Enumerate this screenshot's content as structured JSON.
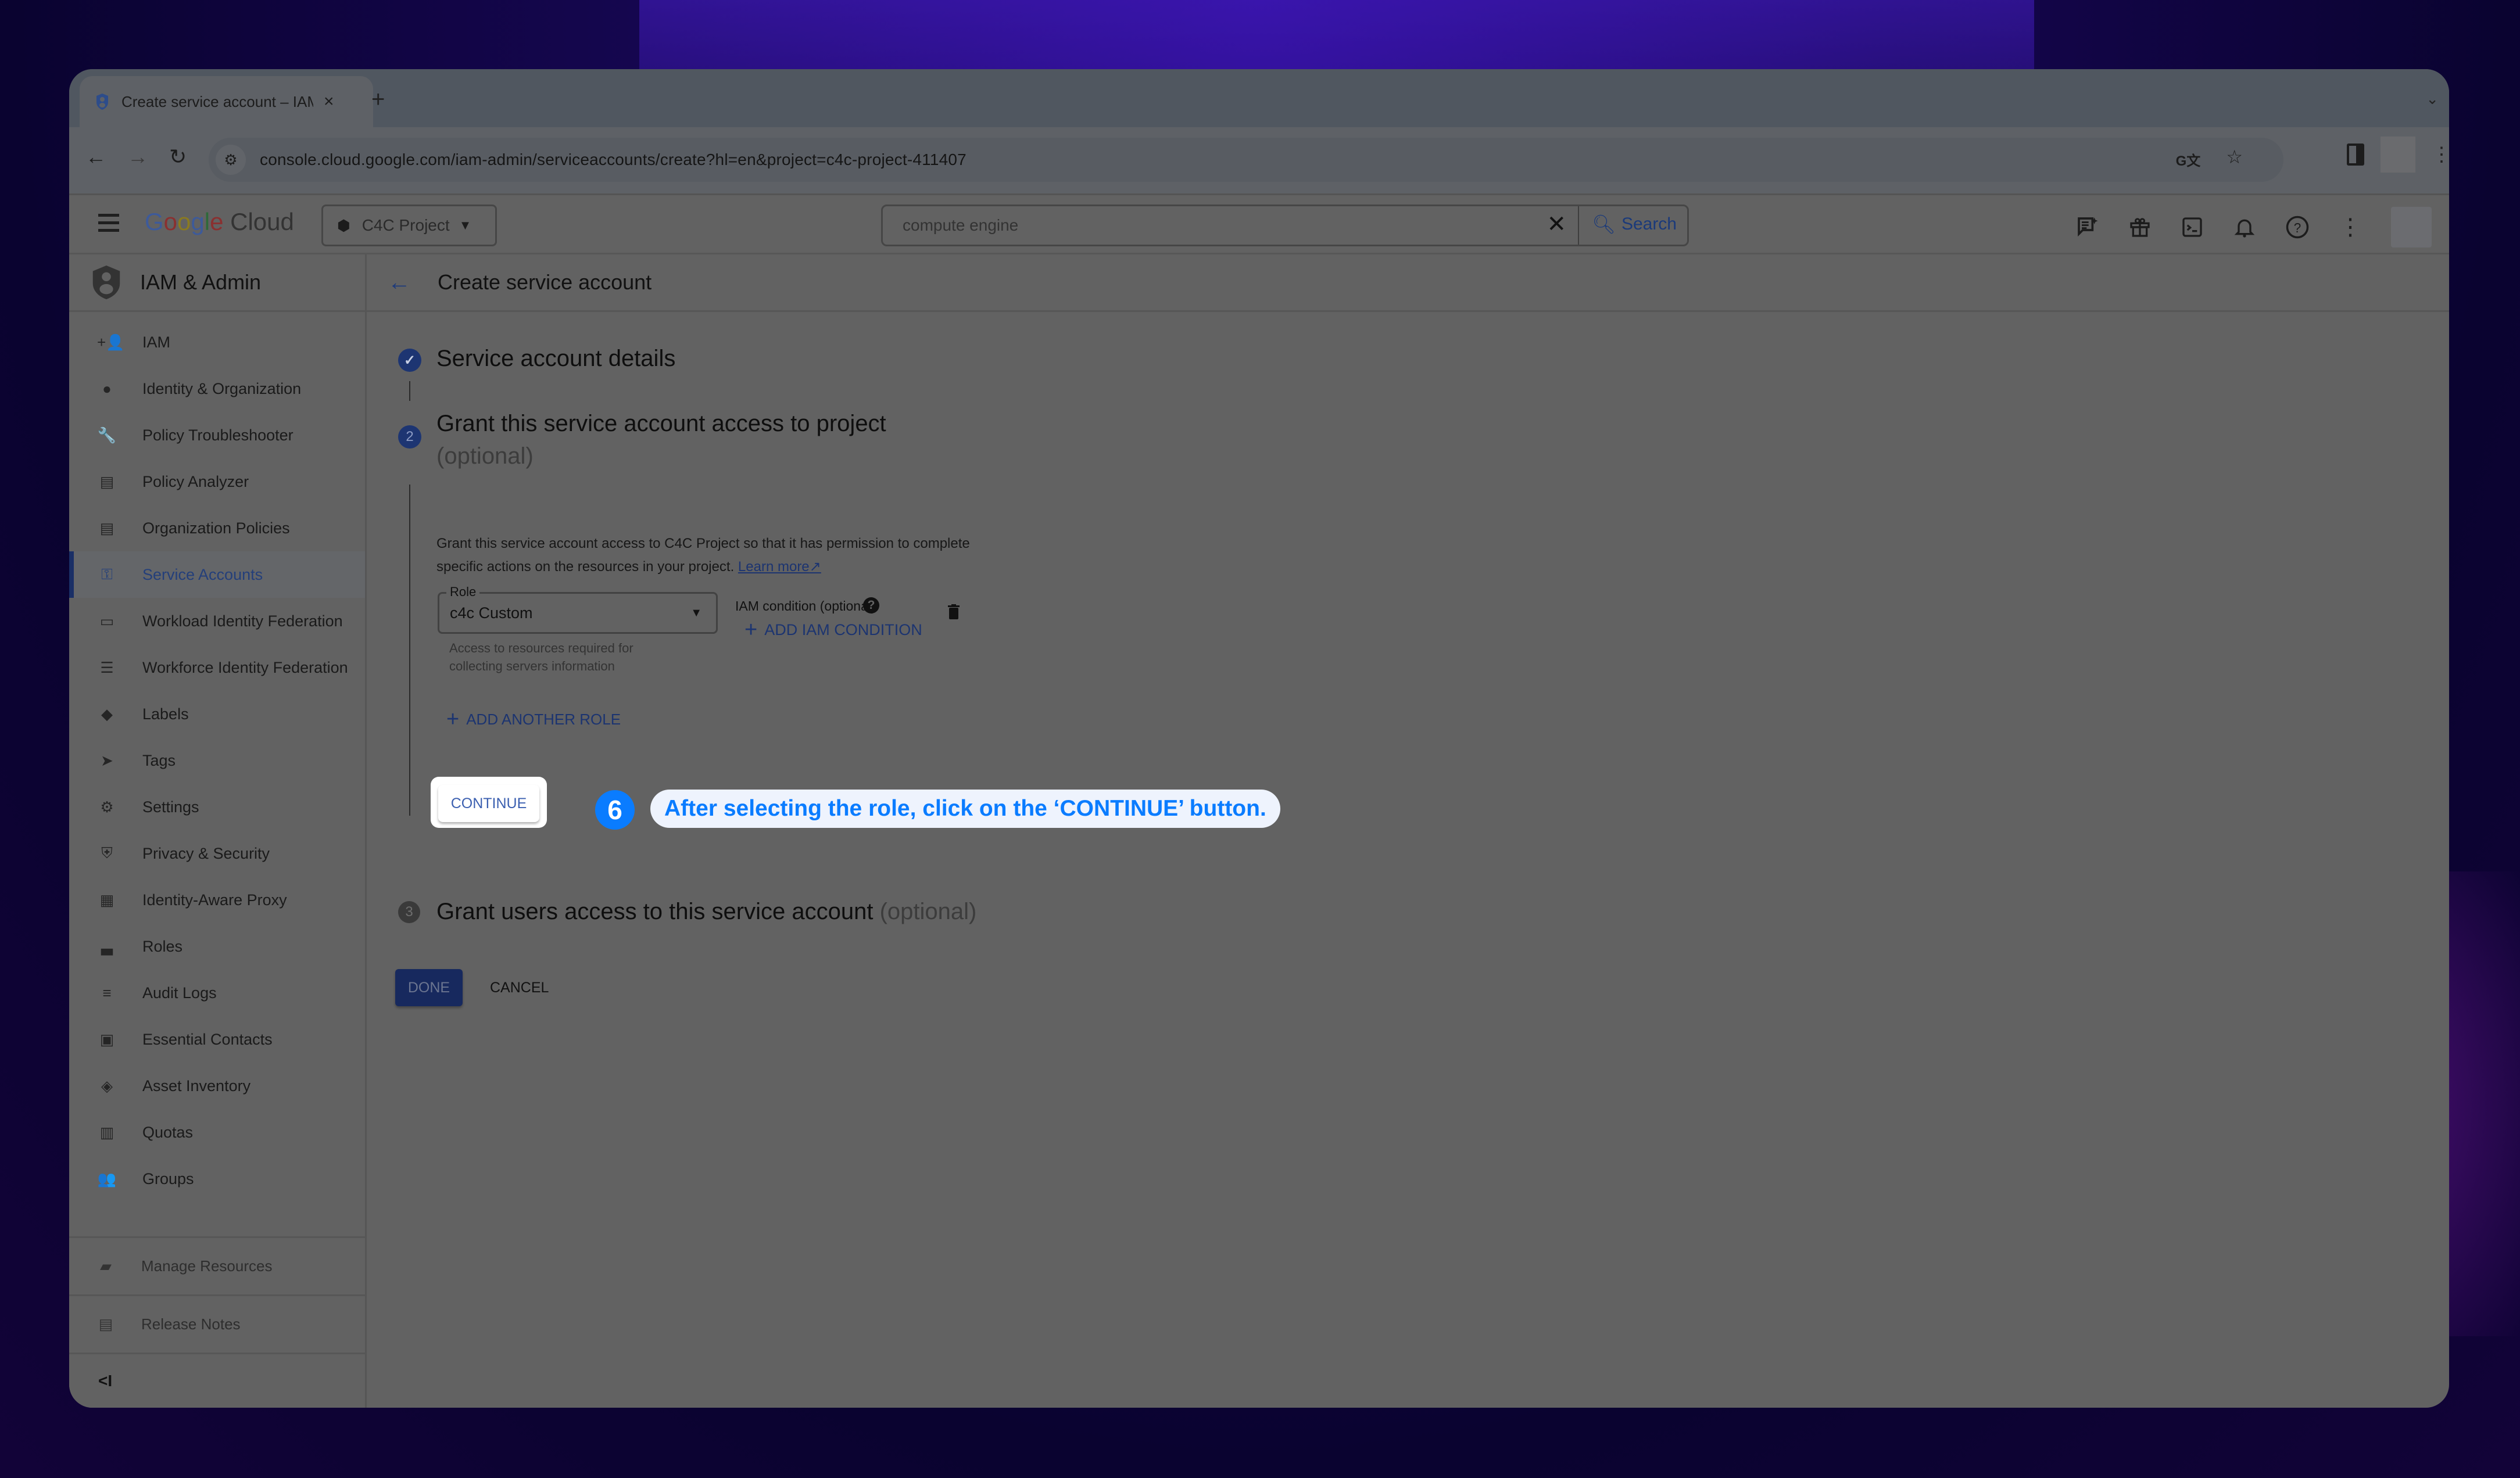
{
  "browser": {
    "tab_title": "Create service account – IAM",
    "tab_close": "×",
    "new_tab": "+",
    "tab_menu": "⌄",
    "url": "console.cloud.google.com/iam-admin/serviceaccounts/create?hl=en&project=c4c-project-411407",
    "back": "←",
    "forward": "→",
    "reload": "↻",
    "site_info": "⚙",
    "translate": "G文",
    "bookmark": "☆",
    "menu": "⋮"
  },
  "gcp_header": {
    "logo": {
      "g1": "G",
      "g2": "o",
      "g3": "o",
      "g4": "g",
      "g5": "l",
      "g6": "e",
      "cloud": " Cloud"
    },
    "project_name": "C4C Project",
    "project_caret": "▼",
    "search_value": "compute engine",
    "search_clear": "✕",
    "search_label": "Search",
    "icons": [
      "gemini-icon",
      "gift-icon",
      "cloud-shell-icon",
      "notifications-icon",
      "help-icon",
      "more-icon"
    ]
  },
  "sidebar": {
    "title": "IAM & Admin",
    "items": [
      {
        "label": "IAM",
        "icon": "person-add-icon",
        "glyph": "+👤"
      },
      {
        "label": "Identity & Organization",
        "icon": "account-circle-icon",
        "glyph": "●"
      },
      {
        "label": "Policy Troubleshooter",
        "icon": "wrench-icon",
        "glyph": "🔧"
      },
      {
        "label": "Policy Analyzer",
        "icon": "policy-analyzer-icon",
        "glyph": "▤"
      },
      {
        "label": "Organization Policies",
        "icon": "org-policies-icon",
        "glyph": "▤"
      },
      {
        "label": "Service Accounts",
        "icon": "service-account-icon",
        "glyph": "⚿",
        "active": true
      },
      {
        "label": "Workload Identity Federation",
        "icon": "workload-identity-icon",
        "glyph": "▭"
      },
      {
        "label": "Workforce Identity Federation",
        "icon": "list-icon",
        "glyph": "☰"
      },
      {
        "label": "Labels",
        "icon": "label-icon",
        "glyph": "◆"
      },
      {
        "label": "Tags",
        "icon": "tag-icon",
        "glyph": "➤"
      },
      {
        "label": "Settings",
        "icon": "gear-icon",
        "glyph": "⚙"
      },
      {
        "label": "Privacy & Security",
        "icon": "shield-icon",
        "glyph": "⛨"
      },
      {
        "label": "Identity-Aware Proxy",
        "icon": "iap-icon",
        "glyph": "▦"
      },
      {
        "label": "Roles",
        "icon": "hat-icon",
        "glyph": "▃"
      },
      {
        "label": "Audit Logs",
        "icon": "audit-logs-icon",
        "glyph": "≡"
      },
      {
        "label": "Essential Contacts",
        "icon": "contacts-icon",
        "glyph": "▣"
      },
      {
        "label": "Asset Inventory",
        "icon": "asset-inventory-icon",
        "glyph": "◈"
      },
      {
        "label": "Quotas",
        "icon": "quotas-icon",
        "glyph": "▥"
      },
      {
        "label": "Groups",
        "icon": "groups-icon",
        "glyph": "👥"
      }
    ],
    "footer": [
      {
        "label": "Manage Resources",
        "icon": "folder-gear-icon",
        "glyph": "▰"
      },
      {
        "label": "Release Notes",
        "icon": "release-notes-icon",
        "glyph": "▤"
      }
    ],
    "collapse": "<I"
  },
  "main": {
    "back": "←",
    "page_title": "Create service account",
    "steps": [
      {
        "num": "✓",
        "title": "Service account details",
        "optional": ""
      },
      {
        "num": "2",
        "title": "Grant this service account access to project",
        "optional": "(optional)"
      },
      {
        "num": "3",
        "title": "Grant users access to this service account",
        "optional": "(optional)"
      }
    ],
    "description": "Grant this service account access to C4C Project so that it has permission to complete specific actions on the resources in your project.",
    "learn_more": "Learn more",
    "learn_more_icon": "↗",
    "role": {
      "label": "Role",
      "value": "c4c Custom",
      "caret": "▼",
      "help": "Access to resources required for collecting servers information"
    },
    "iam_condition_label": "IAM condition (optional)",
    "iam_condition_help": "?",
    "add_iam_condition": "ADD IAM CONDITION",
    "add_another_role": "ADD ANOTHER ROLE",
    "plus": "+",
    "continue": "CONTINUE",
    "done": "DONE",
    "cancel": "CANCEL"
  },
  "callout": {
    "step": "6",
    "text": "After selecting the role, click on the ‘CONTINUE’ button.",
    "color": "#0a7cff"
  }
}
